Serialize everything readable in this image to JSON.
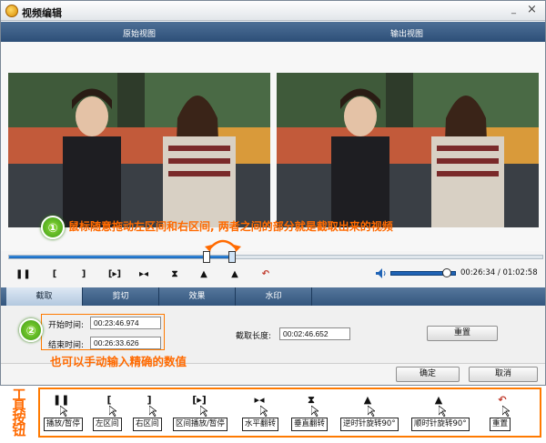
{
  "window": {
    "title": "视频编辑",
    "minimize": "_",
    "close": "×"
  },
  "views": {
    "original_label": "原始视图",
    "output_label": "输出视图"
  },
  "annotations": {
    "step1_num": "①",
    "step1_text": "鼠标随意拖动左区间和右区间, 两者之间的部分就是截取出来的视频",
    "step2_num": "②",
    "step2_text": "也可以手动输入精确的数值",
    "toolbar_title": "工具按钮"
  },
  "timeline": {
    "progress": 0.419,
    "left_handle": 0.37,
    "right_handle": 0.419
  },
  "controls": {
    "play_pause": "❚❚",
    "left_bracket": "[",
    "right_bracket": "]",
    "range_play": "[▸]",
    "flip_h": "▸◂",
    "flip_v": "⧗",
    "rotate_ccw": "▲",
    "rotate_cw": "▲",
    "reset": "↶",
    "volume_level": 0.86,
    "time_readout": "00:26:34 / 01:02:58"
  },
  "tabs": [
    {
      "label": "截取",
      "active": true
    },
    {
      "label": "剪切",
      "active": false
    },
    {
      "label": "效果",
      "active": false
    },
    {
      "label": "水印",
      "active": false
    }
  ],
  "trim": {
    "start_label": "开始时间:",
    "start_value": "00:23:46.974",
    "end_label": "结束时间:",
    "end_value": "00:26:33.626",
    "length_label": "截取长度:",
    "length_value": "00:02:46.652",
    "reset_button": "重置"
  },
  "footer": {
    "ok_button": "确定",
    "cancel_button": "取消"
  },
  "toolbar_items": [
    {
      "icon": "❚❚",
      "label": "播放/暂停"
    },
    {
      "icon": "[",
      "label": "左区间"
    },
    {
      "icon": "]",
      "label": "右区间"
    },
    {
      "icon": "[▸]",
      "label": "区间播放/暂停"
    },
    {
      "icon": "▸◂",
      "label": "水平翻转"
    },
    {
      "icon": "⧗",
      "label": "垂直翻转"
    },
    {
      "icon": "▲",
      "label": "逆时针旋转90°"
    },
    {
      "icon": "▲",
      "label": "顺时针旋转90°"
    },
    {
      "icon": "↶",
      "label": "重置"
    }
  ],
  "colors": {
    "accent_orange": "#ff6a00",
    "header_blue": "#2d4f78",
    "progress_blue": "#1562b8"
  }
}
